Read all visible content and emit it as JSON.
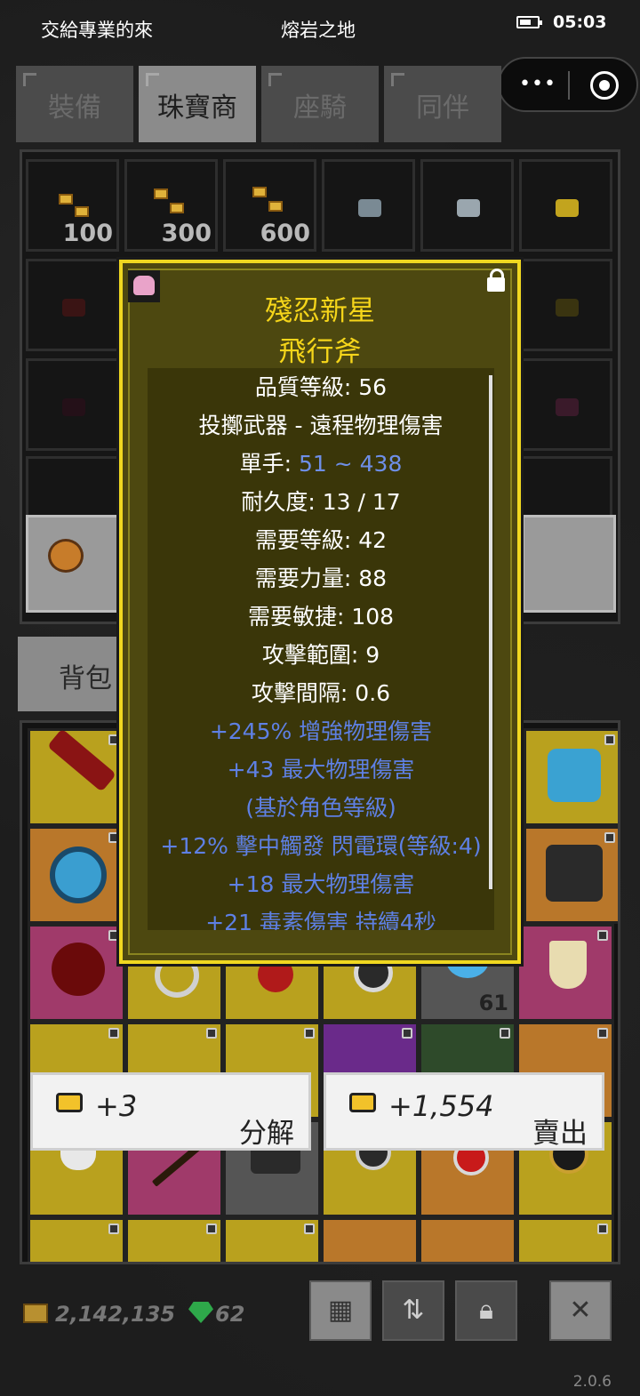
{
  "status_bar": {
    "left_text": "交給專業的來",
    "center_text": "熔岩之地",
    "time": "05:03"
  },
  "tabs": [
    {
      "label": "裝備"
    },
    {
      "label": "珠寶商"
    },
    {
      "label": "座騎"
    },
    {
      "label": "同伴"
    }
  ],
  "shop": {
    "quantities": [
      "100",
      "300",
      "600"
    ]
  },
  "bag_tab": {
    "label": "背包"
  },
  "tooltip": {
    "title": "殘忍新星",
    "subtitle": "飛行斧",
    "lines": [
      "品質等級: 56",
      "投擲武器 - 遠程物理傷害",
      "單手: ",
      "51 ~ 438",
      "耐久度: 13 / 17",
      "需要等級: 42",
      "需要力量: 88",
      "需要敏捷: 108",
      "攻擊範圍: 9",
      "攻擊間隔: 0.6",
      "+245% 增強物理傷害",
      "+43 最大物理傷害",
      "(基於角色等級)",
      "+12% 擊中觸發 閃電環(等級:4)",
      "+18 最大物理傷害",
      "+21 毒素傷害 持續4秒"
    ]
  },
  "inventory": {
    "stack_count": "61"
  },
  "actions": {
    "dismantle": {
      "amount": "+3",
      "label": "分解"
    },
    "sell": {
      "amount": "+1,554",
      "label": "賣出"
    }
  },
  "footer": {
    "coins": "2,142,135",
    "gems": "62",
    "version": "2.0.6"
  },
  "colors": {
    "tooltip_border": "#f0d820",
    "title_yellow": "#f5d51a",
    "affix_blue": "#5e80e4"
  }
}
